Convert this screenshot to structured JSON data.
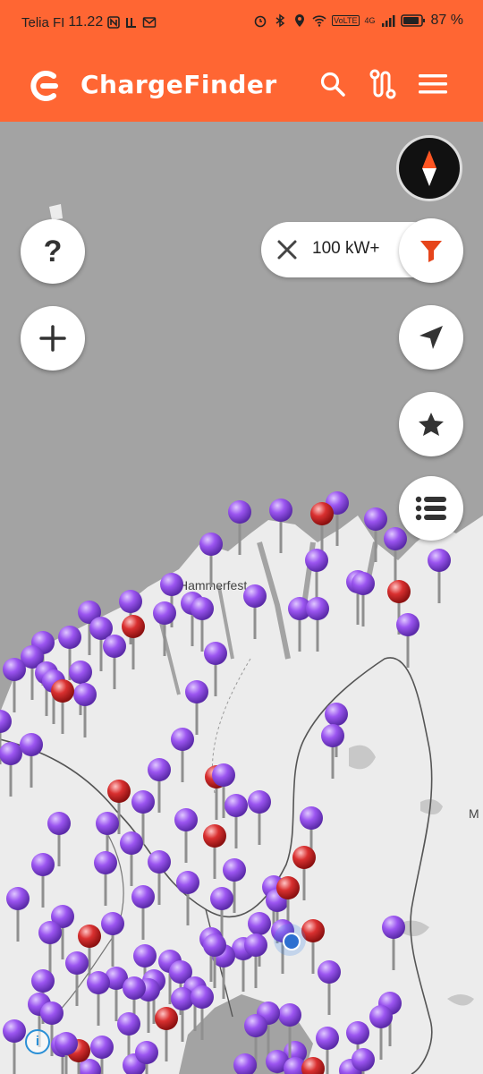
{
  "status_bar": {
    "carrier": "Telia FI",
    "time": "11.22",
    "battery_percent": "87 %",
    "volte": "VoLTE",
    "network": "4G"
  },
  "app_bar": {
    "title": "ChargeFinder",
    "icons": [
      "search-icon",
      "route-icon",
      "menu-icon"
    ]
  },
  "map": {
    "labels": {
      "town": "Hammerfest",
      "edge": "M"
    },
    "pin_colors": {
      "purple": "#9b55f0",
      "red": "#d93030"
    }
  },
  "controls": {
    "help_label": "?",
    "zoom_in_icon": "plus-icon",
    "filter_chip_label": "100 kW+",
    "filter_icon": "funnel-icon",
    "locate_icon": "navigation-arrow-icon",
    "favorites_icon": "star-icon",
    "list_icon": "list-icon"
  },
  "accent_color": "#ff6633"
}
